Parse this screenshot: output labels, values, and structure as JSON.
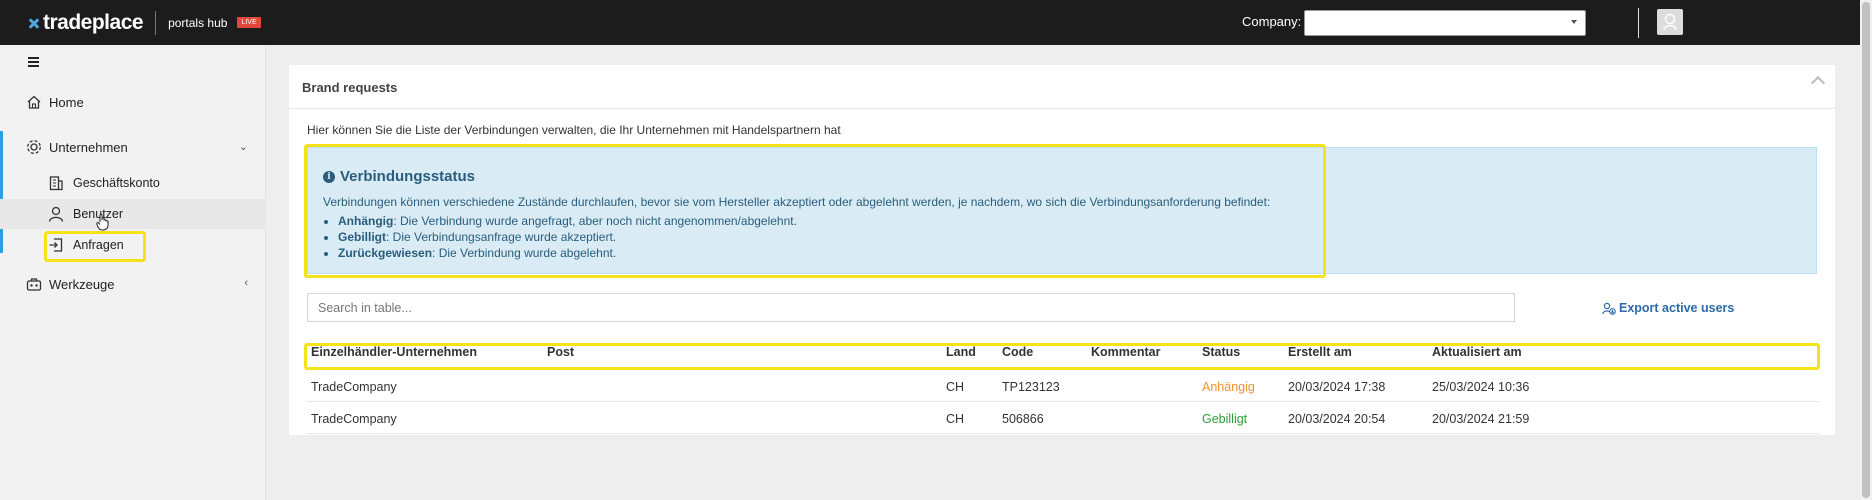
{
  "topbar": {
    "logo_text": "tradeplace",
    "hub_label": "portals hub",
    "badge": "LIVE",
    "company_label": "Company:",
    "company_value": ""
  },
  "sidebar": {
    "items": [
      {
        "label": "Home",
        "icon": "home-icon"
      },
      {
        "label": "Unternehmen",
        "icon": "company-icon"
      },
      {
        "label": "Geschäftskonto",
        "icon": "building-icon"
      },
      {
        "label": "Benutzer",
        "icon": "user-icon"
      },
      {
        "label": "Anfragen",
        "icon": "request-icon"
      },
      {
        "label": "Werkzeuge",
        "icon": "tools-icon"
      }
    ]
  },
  "card": {
    "title": "Brand requests",
    "intro": "Hier können Sie die Liste der Verbindungen verwalten, die Ihr Unternehmen mit Handelspartnern hat",
    "alert": {
      "title": "Verbindungsstatus",
      "desc": "Verbindungen können verschiedene Zustände durchlaufen, bevor sie vom Hersteller akzeptiert oder abgelehnt werden, je nachdem, wo sich die Verbindungsanforderung befindet:",
      "items": [
        {
          "term": "Anhängig",
          "text": ": Die Verbindung wurde angefragt, aber noch nicht angenommen/abgelehnt."
        },
        {
          "term": "Gebilligt",
          "text": ": Die Verbindungsanfrage wurde akzeptiert."
        },
        {
          "term": "Zurückgewiesen",
          "text": ": Die Verbindung wurde abgelehnt."
        }
      ]
    },
    "search_placeholder": "Search in table...",
    "export_label": "Export active users"
  },
  "table": {
    "columns": [
      "Einzelhändler-Unternehmen",
      "Post",
      "Land",
      "Code",
      "Kommentar",
      "Status",
      "Erstellt am",
      "Aktualisiert am"
    ],
    "rows": [
      {
        "company": "TradeCompany",
        "post": "",
        "land": "CH",
        "code": "TP123123",
        "comment": "",
        "status": "Anhängig",
        "created": "20/03/2024 17:38",
        "updated": "25/03/2024 10:36"
      },
      {
        "company": "TradeCompany",
        "post": "",
        "land": "CH",
        "code": "506866",
        "comment": "",
        "status": "Gebilligt",
        "created": "20/03/2024 20:54",
        "updated": "20/03/2024 21:59"
      }
    ]
  },
  "colors": {
    "topbar": "#1c1c1c",
    "accent": "#2aa0df",
    "pending": "#f0912e",
    "approved": "#2e9e34",
    "highlight": "#f4e21b"
  }
}
